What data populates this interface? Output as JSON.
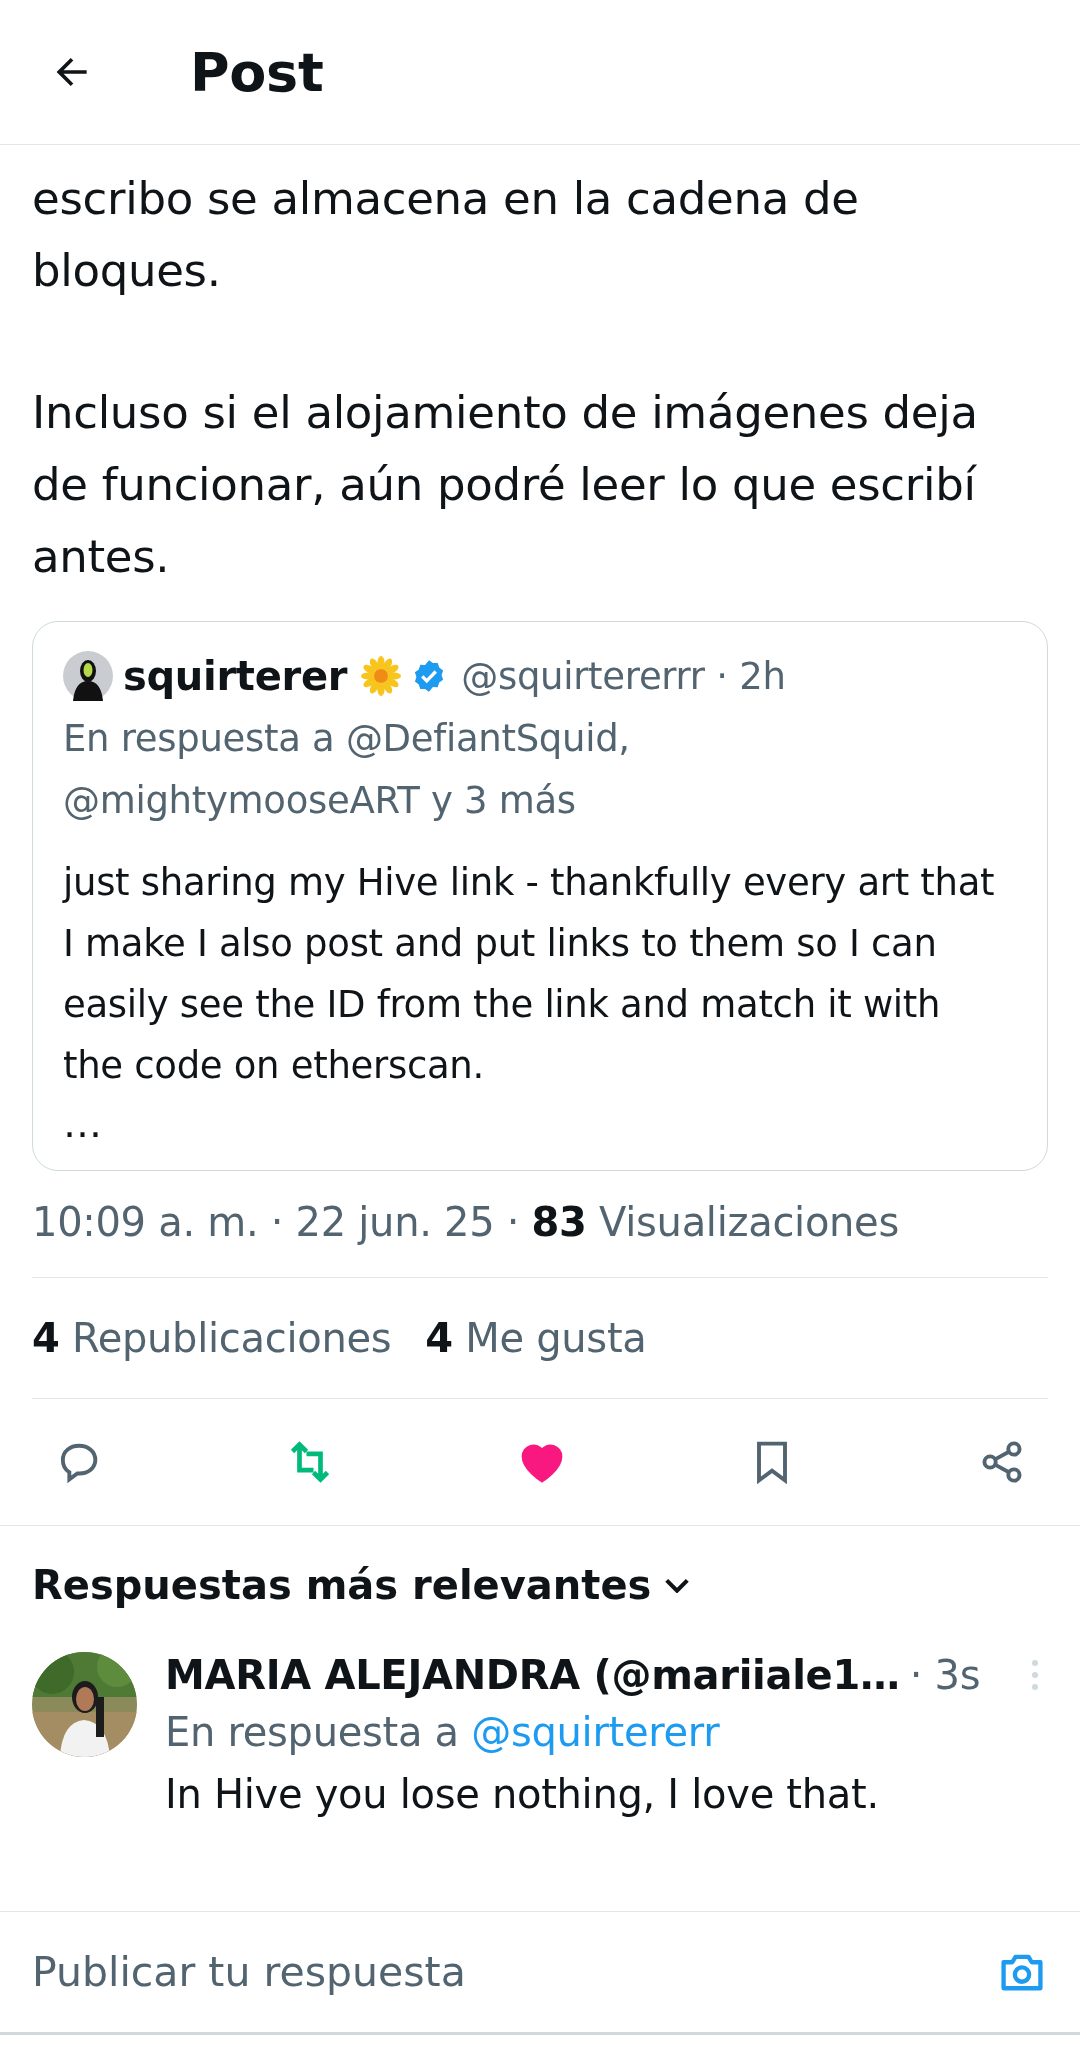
{
  "header": {
    "title": "Post"
  },
  "post": {
    "paragraphs": [
      "escribo se almacena en la cadena de bloques.",
      "Incluso si el alojamiento de imágenes deja de funcionar, aún podré leer lo que escribí antes."
    ]
  },
  "quote": {
    "name": "squirterer",
    "verified": true,
    "handle_time": "@squirtererrr · 2h",
    "reply_to": "En respuesta a @DefiantSquid, @mightymooseART y 3 más",
    "text": "just sharing my Hive link - thankfully every art that I make I also post and put links to them so I can easily see the ID from the link and match it with the code on etherscan.",
    "more": "…"
  },
  "meta": "10:09 a. m. · 22 jun. 25 · **83** Visualizaciones",
  "stats": [
    {
      "count": "4",
      "label": "Republicaciones"
    },
    {
      "count": "4",
      "label": "Me gusta"
    }
  ],
  "actions": [
    {
      "kind": "reply",
      "active": false
    },
    {
      "kind": "repost",
      "active": true
    },
    {
      "kind": "like",
      "active": true
    },
    {
      "kind": "bookmark",
      "active": false
    },
    {
      "kind": "share",
      "active": false
    }
  ],
  "replies": {
    "sort_label": "Respuestas más relevantes",
    "items": [
      {
        "name": "MARIA ALEJANDRA (@mariiale1…",
        "time": "· 3s",
        "reply_prefix": "En respuesta a",
        "reply_to": "@squirtererr",
        "text": "In Hive you lose nothing, I love that."
      }
    ]
  },
  "compose": {
    "placeholder": "Publicar tu respuesta"
  }
}
